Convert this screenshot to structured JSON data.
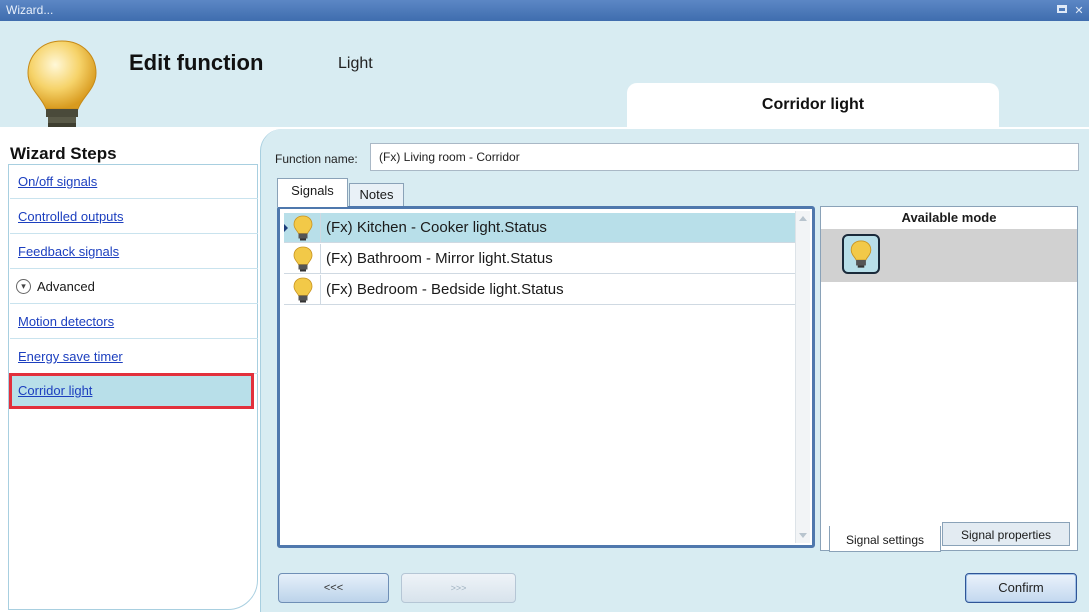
{
  "window": {
    "title": "Wizard..."
  },
  "header": {
    "title": "Edit function",
    "subtitle": "Light",
    "step_tab": "Corridor light"
  },
  "sidebar": {
    "title": "Wizard Steps",
    "items": [
      {
        "label": "On/off signals"
      },
      {
        "label": "Controlled outputs"
      },
      {
        "label": "Feedback signals"
      },
      {
        "label": "Advanced"
      },
      {
        "label": "Motion detectors"
      },
      {
        "label": "Energy save timer"
      },
      {
        "label": "Corridor light"
      }
    ]
  },
  "main": {
    "function_name_label": "Function name:",
    "function_name_value": "(Fx) Living room - Corridor",
    "tabs": [
      {
        "label": "Signals"
      },
      {
        "label": "Notes"
      }
    ],
    "signals": [
      {
        "name": "(Fx) Kitchen - Cooker light.Status"
      },
      {
        "name": "(Fx) Bathroom - Mirror light.Status"
      },
      {
        "name": "(Fx) Bedroom - Bedside light.Status"
      }
    ],
    "available_mode_title": "Available mode",
    "panel_tabs": [
      {
        "label": "Signal settings"
      },
      {
        "label": "Signal properties"
      }
    ],
    "buttons": {
      "back": "<<<",
      "next": ">>>",
      "confirm": "Confirm"
    }
  },
  "colors": {
    "titlebar": "#4a78b8",
    "panel_bg": "#d8ecf2",
    "selection": "#b8dfe9",
    "highlight_box": "#e2303c",
    "link": "#1c3fbf"
  },
  "icons": {
    "bulb": "light-bulb-icon",
    "advanced": "chevron-down-circle-icon"
  }
}
